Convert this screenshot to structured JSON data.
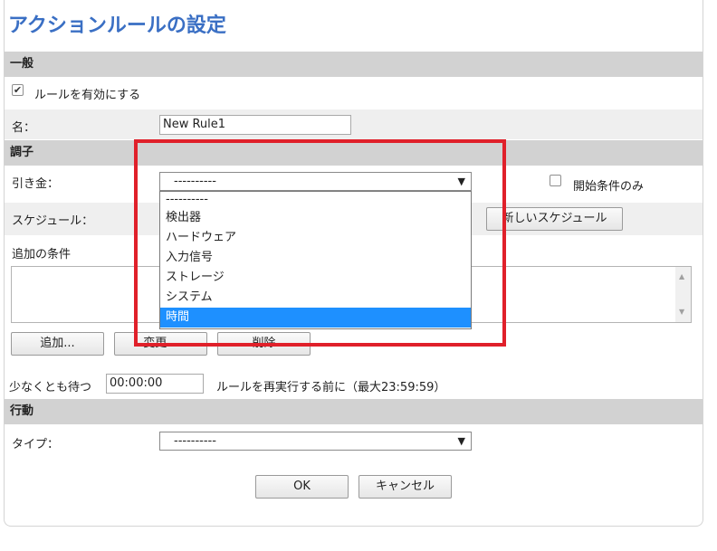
{
  "page": {
    "title": "アクションルールの設定"
  },
  "general": {
    "header": "一般",
    "enable_label": "ルールを有効にする",
    "enable_checked": true,
    "name_label": "名：",
    "name_value": "New Rule1"
  },
  "conditions": {
    "header": "調子",
    "trigger_label": "引き金：",
    "trigger_value": "----------",
    "start_only_label": "開始条件のみ",
    "start_only_checked": false,
    "schedule_label": "スケジュール：",
    "new_schedule_button": "新しいスケジュール",
    "additional_label": "追加の条件",
    "add_button": "追加...",
    "change_button": "変更...",
    "delete_button": "削除",
    "wait_label": "少なくとも待つ",
    "wait_value": "00:00:00",
    "wait_suffix": "ルールを再実行する前に（最大23:59:59）"
  },
  "trigger_dropdown": {
    "options": [
      "----------",
      "検出器",
      "ハードウェア",
      "入力信号",
      "ストレージ",
      "システム",
      "時間"
    ],
    "hovered": "時間"
  },
  "action": {
    "header": "行動",
    "type_label": "タイプ：",
    "type_value": "----------"
  },
  "footer": {
    "ok_button": "OK",
    "cancel_button": "キャンセル"
  },
  "colors": {
    "title": "#3a6fc4",
    "section_bg": "#d2d2d2",
    "highlight_box": "#e0202a",
    "dropdown_selected": "#1e90ff"
  },
  "icons": {
    "dropdown_arrow": "chevron-down-icon",
    "checkbox_check": "check-icon"
  }
}
